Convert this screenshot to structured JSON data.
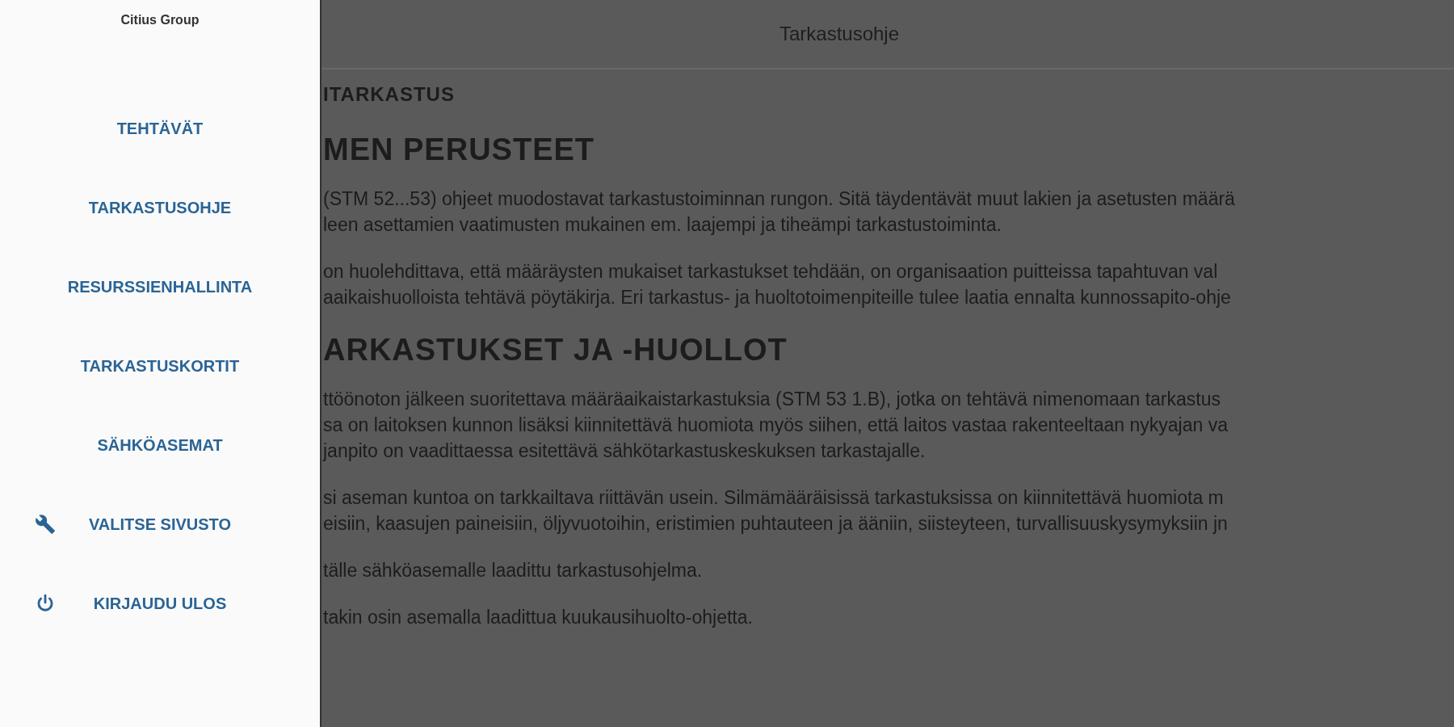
{
  "sidebar": {
    "brand": "Citius Group",
    "items": [
      {
        "label": "TEHTÄVÄT",
        "kind": "plain"
      },
      {
        "label": "TARKASTUSOHJE",
        "kind": "plain"
      },
      {
        "label": "RESURSSIENHALLINTA",
        "kind": "plain"
      },
      {
        "label": "TARKASTUSKORTIT",
        "kind": "plain"
      },
      {
        "label": "SÄHKÖASEMAT",
        "kind": "plain"
      },
      {
        "label": "VALITSE SIVUSTO",
        "kind": "tools"
      },
      {
        "label": "KIRJAUDU ULOS",
        "kind": "power"
      }
    ]
  },
  "header": {
    "title": "Tarkastusohje"
  },
  "content": [
    {
      "kind": "label",
      "lines": [
        "ITARKASTUS"
      ]
    },
    {
      "kind": "heading",
      "lines": [
        "MEN PERUSTEET"
      ]
    },
    {
      "kind": "paragraph",
      "lines": [
        "(STM 52...53) ohjeet muodostavat tarkastustoiminnan rungon. Sitä täydentävät muut lakien ja asetusten määrä",
        "leen asettamien vaatimusten mukainen em. laajempi ja tiheämpi tarkastustoiminta."
      ]
    },
    {
      "kind": "paragraph",
      "lines": [
        "on huolehdittava, että määräysten mukaiset tarkastukset tehdään, on organisaation puitteissa tapahtuvan val",
        "aaikaishuolloista tehtävä pöytäkirja. Eri tarkastus- ja huoltotoimenpiteille tulee laatia ennalta kunnossapito-ohje"
      ]
    },
    {
      "kind": "heading",
      "lines": [
        "ARKASTUKSET JA -HUOLLOT"
      ]
    },
    {
      "kind": "paragraph",
      "lines": [
        "ttöönoton jälkeen suoritettava määräaikaistarkastuksia (STM 53 1.B), jotka on tehtävä nimenomaan tarkastus",
        "sa on laitoksen kunnon lisäksi kiinnitettävä huomiota myös siihen, että laitos vastaa rakenteeltaan nykyajan va",
        "janpito on vaadittaessa esitettävä sähkötarkastuskeskuksen tarkastajalle."
      ]
    },
    {
      "kind": "paragraph",
      "lines": [
        "si aseman kuntoa on tarkkailtava riittävän usein. Silmämääräisissä tarkastuksissa on kiinnitettävä huomiota m",
        "eisiin, kaasujen paineisiin, öljyvuotoihin, eristimien puhtauteen ja ääniin, siisteyteen, turvallisuuskysymyksiin jn"
      ]
    },
    {
      "kind": "paragraph",
      "lines": [
        "tälle sähköasemalle laadittu tarkastusohjelma."
      ]
    },
    {
      "kind": "paragraph",
      "lines": [
        "takin osin asemalla laadittua kuukausihuolto-ohjetta."
      ]
    }
  ]
}
